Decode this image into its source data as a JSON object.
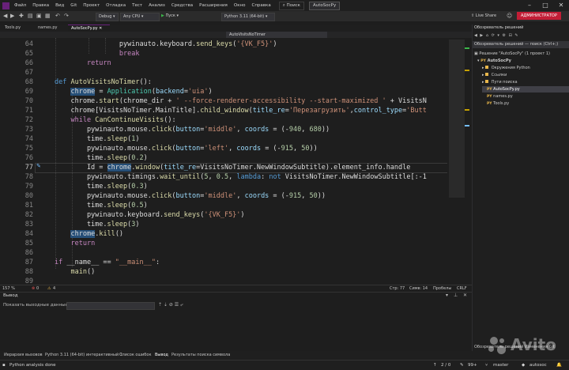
{
  "menu": [
    "Файл",
    "Правка",
    "Вид",
    "Git",
    "Проект",
    "Отладка",
    "Тест",
    "Анализ",
    "Средства",
    "Расширения",
    "Окно",
    "Справка"
  ],
  "search_label": "Поиск",
  "project_name": "AutoSocPy",
  "toolbar": {
    "config": "Debug",
    "platform": "Any CPU",
    "start": "Пуск",
    "interpreter": "Python 3.11 (64-bit)",
    "live_share": "Live Share",
    "admin": "АДМИНИСТРАТОР"
  },
  "doc_tabs": [
    "Tools.py",
    "names.py",
    "AutoSocPy.py"
  ],
  "nav_method": "AutoVisitsNoTimer",
  "code_lines": [
    {
      "n": "64"
    },
    {
      "n": "65"
    },
    {
      "n": "66"
    },
    {
      "n": "67"
    },
    {
      "n": "68"
    },
    {
      "n": "69"
    },
    {
      "n": "70"
    },
    {
      "n": "71"
    },
    {
      "n": "72"
    },
    {
      "n": "73"
    },
    {
      "n": "74"
    },
    {
      "n": "75"
    },
    {
      "n": "76"
    },
    {
      "n": "77"
    },
    {
      "n": "78"
    },
    {
      "n": "79"
    },
    {
      "n": "80"
    },
    {
      "n": "81"
    },
    {
      "n": "82"
    },
    {
      "n": "83"
    },
    {
      "n": "84"
    },
    {
      "n": "85"
    },
    {
      "n": "86"
    },
    {
      "n": "87"
    },
    {
      "n": "88"
    },
    {
      "n": "89"
    }
  ],
  "editor_status": {
    "zoom": "157 %",
    "errors": "0",
    "warnings": "4",
    "line": "Стр: 77",
    "col": "Симв: 14",
    "spaces": "Пробелы",
    "eol": "CRLF"
  },
  "solution_explorer": {
    "title": "Обозреватель решений",
    "search": "Обозреватель решений — поиск (Ctrl+;)",
    "items": [
      {
        "label": "Решение \"AutoSocPy\" (1 проект 1)",
        "icon": "solution-icon"
      },
      {
        "label": "AutoSocPy",
        "icon": "python-project-icon"
      },
      {
        "label": "Окружения Python",
        "icon": "folder-icon"
      },
      {
        "label": "Ссылки",
        "icon": "folder-icon"
      },
      {
        "label": "Пути поиска",
        "icon": "folder-icon"
      },
      {
        "label": "AutoSocPy.py",
        "icon": "python-file-icon"
      },
      {
        "label": "names.py",
        "icon": "python-file-icon"
      },
      {
        "label": "Tools.py",
        "icon": "python-file-icon"
      }
    ]
  },
  "output": {
    "title": "Вывод",
    "source_label": "Показать выходные данные из:"
  },
  "bottom_tabs": [
    "Иерархия вызовов",
    "Python 3.11 (64-bit) интерактивный 1",
    "Список ошибок",
    "Вывод",
    "Результаты поиска символа"
  ],
  "right_bottom_tabs": [
    "Обозреватель решений",
    "Изменения Git"
  ],
  "status": {
    "message": "Python analysis done",
    "pages": "2 / 0",
    "pencil": "99+",
    "branch": "master",
    "repo": "autosoc"
  },
  "watermark": "Avito",
  "colors": {
    "accent": "#68217a",
    "admin": "#c21d36",
    "keyword": "#c586c0",
    "function": "#dcdcaa",
    "string": "#ce9178",
    "number": "#b5cea8"
  }
}
